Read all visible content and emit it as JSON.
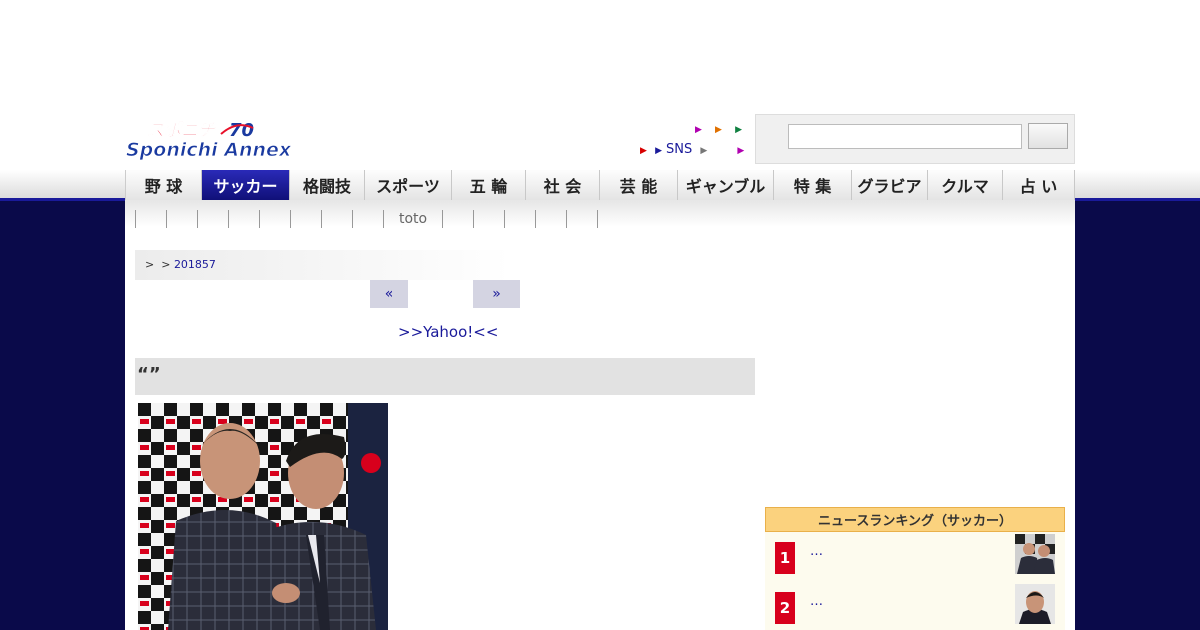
{
  "header": {
    "logo_alt": "Sponichi Annex",
    "logo_text": "Sponichi Annex",
    "logo_kana": "スポニチ",
    "sns_label": "SNS",
    "search": {
      "placeholder": "",
      "button_label": ""
    }
  },
  "colors": {
    "navy": "#0a0a4a",
    "active_tab": "#1a1a9a",
    "rank_badge": "#d8001c",
    "rank_header": "#fbd27e"
  },
  "nav": {
    "items": [
      "野 球",
      "サッカー",
      "格闘技",
      "スポーツ",
      "五 輪",
      "社 会",
      "芸 能",
      "ギャンブル",
      "特 集",
      "グラビア",
      "クルマ",
      "占 い"
    ],
    "active": "サッカー"
  },
  "subnav": {
    "toto_label": "toto"
  },
  "breadcrumb": {
    "sep1": ">",
    "sep2": ">",
    "date": "201857"
  },
  "pager": {
    "prev": "«",
    "next": "»"
  },
  "article": {
    "yahoo_link": ">>Yahoo!<<",
    "headline": "“”"
  },
  "ranking": {
    "title": "ニュースランキング（サッカー）",
    "items": [
      {
        "rank": "1",
        "text": "…"
      },
      {
        "rank": "2",
        "text": "…"
      }
    ]
  }
}
